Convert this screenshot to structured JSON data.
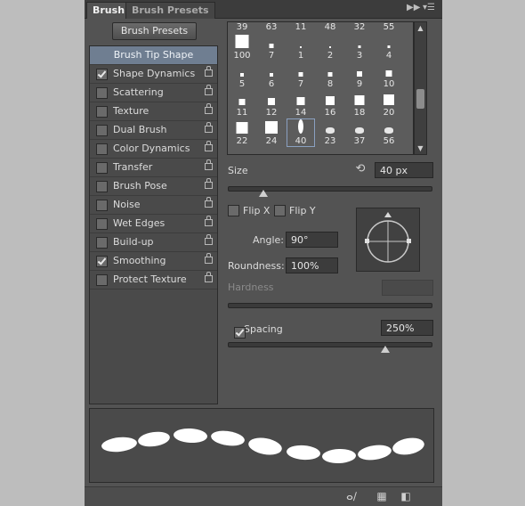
{
  "tabs": {
    "active": "Brush",
    "inactive": "Brush Presets"
  },
  "tab_menu_icons": [
    "double-arrow-icon",
    "panel-menu-icon"
  ],
  "brush_presets_button": "Brush Presets",
  "options_list": [
    {
      "label": "Brush Tip Shape",
      "heading": true
    },
    {
      "label": "Shape Dynamics",
      "checked": true,
      "locked": true
    },
    {
      "label": "Scattering",
      "checked": false,
      "locked": true
    },
    {
      "label": "Texture",
      "checked": false,
      "locked": true
    },
    {
      "label": "Dual Brush",
      "checked": false,
      "locked": true
    },
    {
      "label": "Color Dynamics",
      "checked": false,
      "locked": true
    },
    {
      "label": "Transfer",
      "checked": false,
      "locked": true
    },
    {
      "label": "Brush Pose",
      "checked": false,
      "locked": true
    },
    {
      "label": "Noise",
      "checked": false,
      "locked": true
    },
    {
      "label": "Wet Edges",
      "checked": false,
      "locked": true
    },
    {
      "label": "Build-up",
      "checked": false,
      "locked": true
    },
    {
      "label": "Smoothing",
      "checked": true,
      "locked": true
    },
    {
      "label": "Protect Texture",
      "checked": false,
      "locked": true
    }
  ],
  "brush_grid": [
    {
      "size": "39"
    },
    {
      "size": "63"
    },
    {
      "size": "11"
    },
    {
      "size": "48"
    },
    {
      "size": "32"
    },
    {
      "size": "55"
    },
    {
      "size": "100"
    },
    {
      "size": "7"
    },
    {
      "size": "1"
    },
    {
      "size": "2"
    },
    {
      "size": "3"
    },
    {
      "size": "4"
    },
    {
      "size": "5"
    },
    {
      "size": "6"
    },
    {
      "size": "7"
    },
    {
      "size": "8"
    },
    {
      "size": "9"
    },
    {
      "size": "10"
    },
    {
      "size": "11"
    },
    {
      "size": "12"
    },
    {
      "size": "14"
    },
    {
      "size": "16"
    },
    {
      "size": "18"
    },
    {
      "size": "20"
    },
    {
      "size": "22"
    },
    {
      "size": "24"
    },
    {
      "size": "40",
      "selected": true
    },
    {
      "size": "23"
    },
    {
      "size": "37"
    },
    {
      "size": "56"
    }
  ],
  "size": {
    "label": "Size",
    "value": "40 px",
    "slider_fraction": 0.17
  },
  "flip_x": {
    "label": "Flip X",
    "checked": false
  },
  "flip_y": {
    "label": "Flip Y",
    "checked": false
  },
  "angle": {
    "label": "Angle:",
    "value": "90°"
  },
  "roundness": {
    "label": "Roundness:",
    "value": "100%"
  },
  "hardness": {
    "label": "Hardness",
    "value": ""
  },
  "spacing": {
    "label": "Spacing",
    "checked": true,
    "value": "250%",
    "slider_fraction": 0.77
  },
  "bottom_icons": [
    "toggle-brush-preview-icon",
    "grid-preset-icon",
    "new-preset-icon"
  ]
}
